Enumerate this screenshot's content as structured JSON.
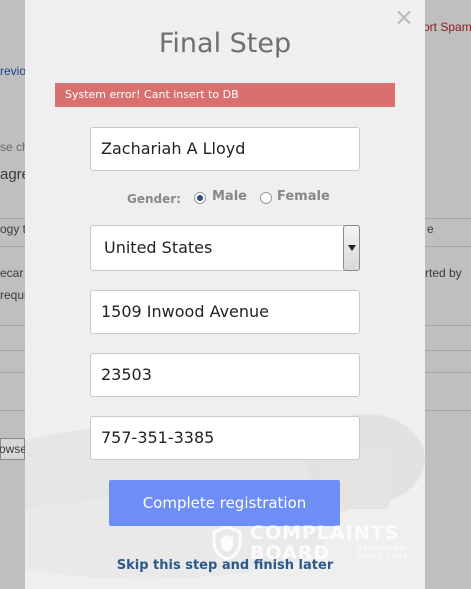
{
  "background": {
    "top_right_link": "ort Spam",
    "previous_link": "revio",
    "snippets": [
      "se ch",
      "agre",
      "ogy th",
      "e",
      "ecar",
      "rted by",
      "requi",
      "owse"
    ]
  },
  "modal": {
    "title": "Final Step",
    "error_message": "System error! Cant insert to DB",
    "fields": {
      "name": "Zachariah A Lloyd",
      "country": "United States",
      "address": "1509 Inwood Avenue",
      "zip": "23503",
      "phone": "757-351-3385"
    },
    "gender": {
      "label": "Gender:",
      "options": [
        "Male",
        "Female"
      ],
      "selected": "Male"
    },
    "submit_label": "Complete registration",
    "skip_label": "Skip this step and finish later"
  },
  "watermark": {
    "line1": "COMPLAINTS",
    "line2": "BOARD",
    "tag1": "RESOLVING",
    "tag2": "SINCE 2004"
  },
  "colors": {
    "error_bg": "#d97070",
    "submit_bg": "#6e8ef6",
    "link": "#2b5a8a"
  }
}
